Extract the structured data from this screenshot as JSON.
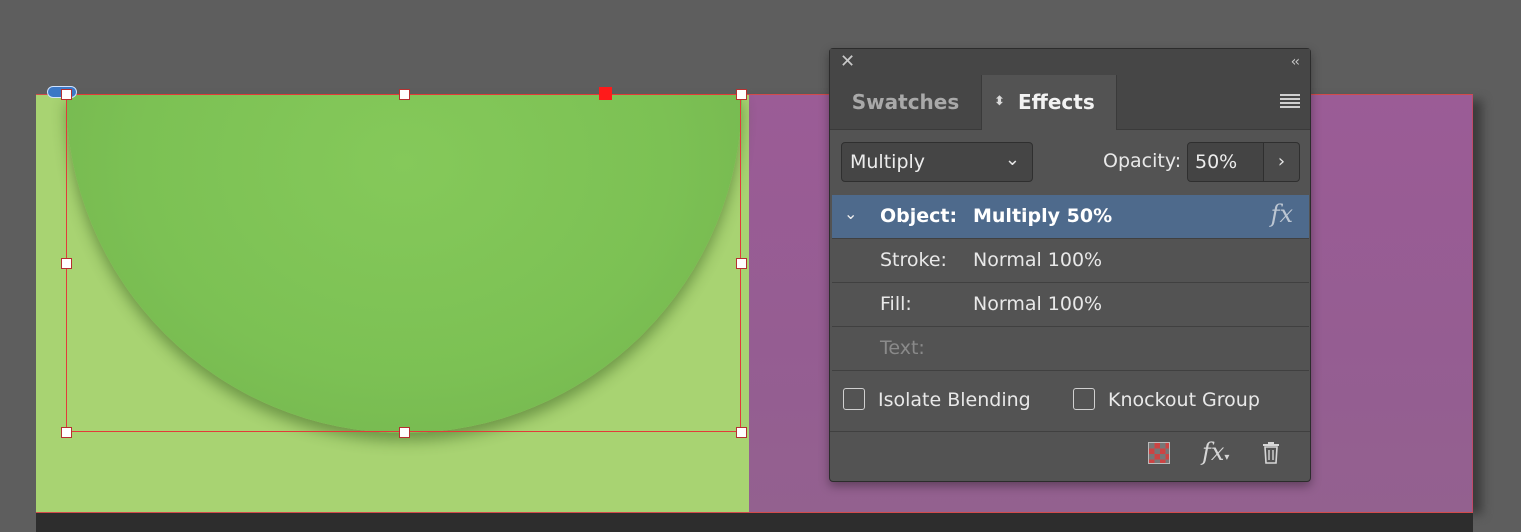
{
  "panel": {
    "tabs": [
      {
        "label": "Swatches"
      },
      {
        "label": "Effects"
      }
    ],
    "blend_mode": {
      "value": "Multiply"
    },
    "opacity": {
      "label": "Opacity:",
      "value": "50%"
    },
    "rows": [
      {
        "label": "Object:",
        "value": "Multiply 50%"
      },
      {
        "label": "Stroke:",
        "value": "Normal 100%"
      },
      {
        "label": "Fill:",
        "value": "Normal 100%"
      },
      {
        "label": "Text:",
        "value": ""
      }
    ],
    "checkboxes": {
      "isolate": {
        "label": "Isolate Blending",
        "checked": false
      },
      "knockout": {
        "label": "Knockout Group",
        "checked": false
      }
    },
    "icons": [
      "close-icon",
      "collapse-icon",
      "panel-menu-icon",
      "chevron-down-icon",
      "chevron-right-icon",
      "fx-icon",
      "clear-effects-icon",
      "trash-icon"
    ]
  },
  "colors": {
    "left_page": "#a8d372",
    "right_page": "#985c95",
    "half_circle": "#7cc154",
    "selection": "#e23a3a",
    "selected_row": "#4e6a8c",
    "panel_bg": "#535353"
  }
}
